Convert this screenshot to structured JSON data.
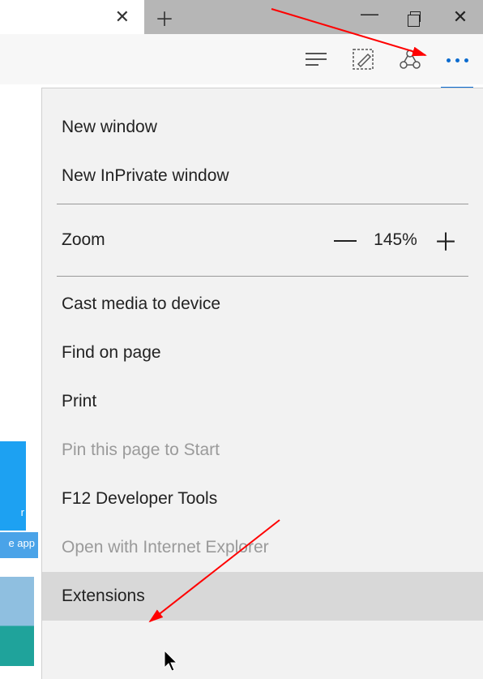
{
  "titlebar": {
    "window_controls": {
      "minimize": "—",
      "restore": "❐",
      "close": "✕"
    }
  },
  "toolbar": {
    "items": [
      "hub",
      "webnote",
      "share",
      "more"
    ]
  },
  "menu": {
    "new_window": "New window",
    "new_inprivate": "New InPrivate window",
    "zoom_label": "Zoom",
    "zoom_value": "145%",
    "cast": "Cast media to device",
    "find": "Find on page",
    "print": "Print",
    "pin": "Pin this page to Start",
    "f12": "F12 Developer Tools",
    "open_ie": "Open with Internet Explorer",
    "extensions": "Extensions"
  },
  "sliver": {
    "twitter_tail": "r",
    "app_tail": "e app"
  }
}
